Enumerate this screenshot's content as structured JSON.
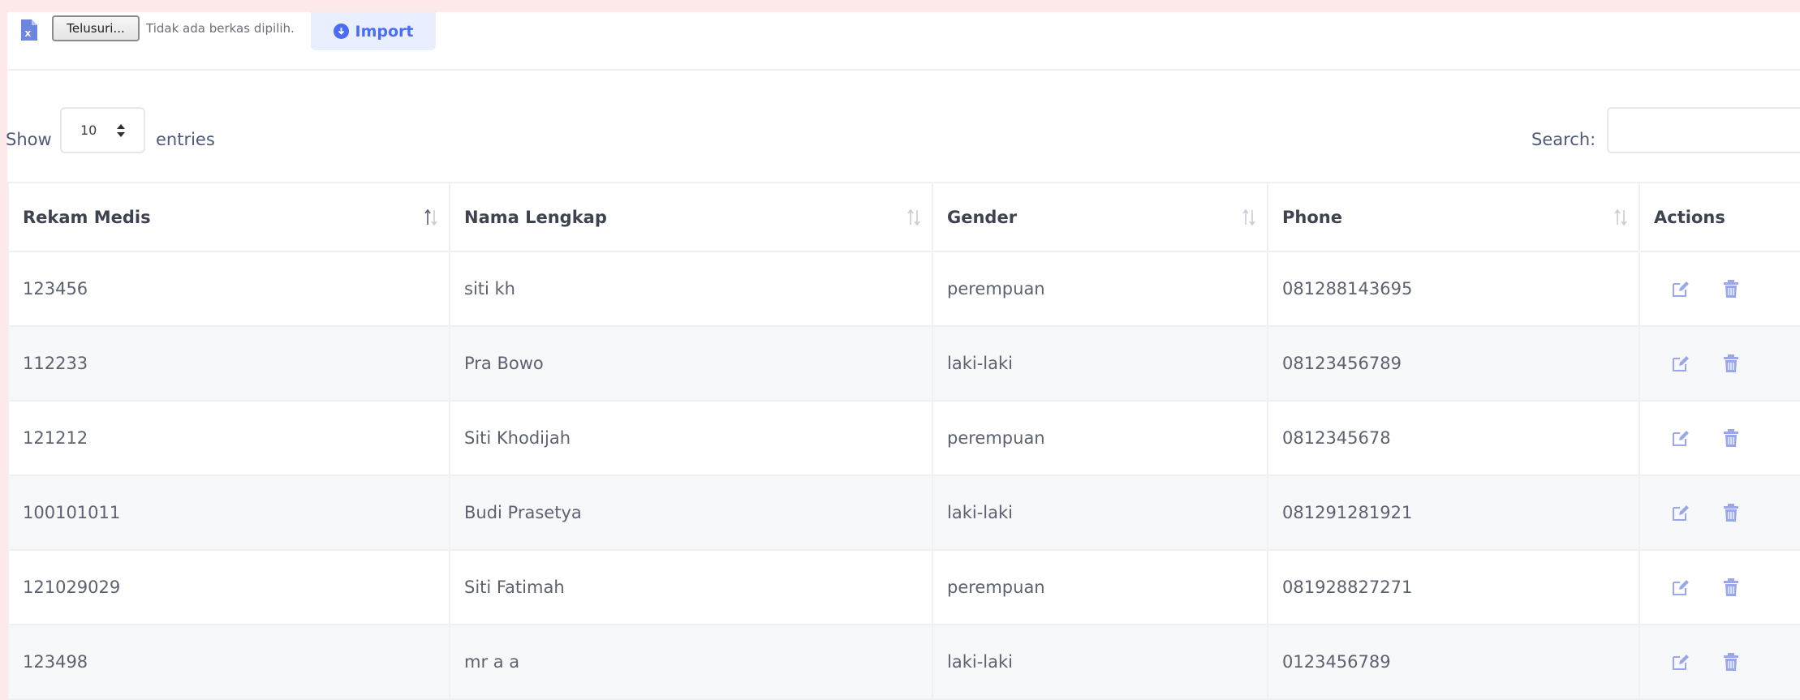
{
  "import_bar": {
    "file_button": "Telusuri...",
    "file_status": "Tidak ada berkas dipilih.",
    "import_label": "Import"
  },
  "length": {
    "show_label": "Show",
    "value": "10",
    "entries_label": "entries"
  },
  "search": {
    "label": "Search:",
    "value": ""
  },
  "table": {
    "headers": [
      "Rekam Medis",
      "Nama Lengkap",
      "Gender",
      "Phone",
      "Actions"
    ],
    "rows": [
      {
        "rm": "123456",
        "nama": "siti kh",
        "gender": "perempuan",
        "phone": "081288143695"
      },
      {
        "rm": "112233",
        "nama": "Pra Bowo",
        "gender": "laki-laki",
        "phone": "08123456789"
      },
      {
        "rm": "121212",
        "nama": "Siti Khodijah",
        "gender": "perempuan",
        "phone": "0812345678"
      },
      {
        "rm": "100101011",
        "nama": "Budi Prasetya",
        "gender": "laki-laki",
        "phone": "081291281921"
      },
      {
        "rm": "121029029",
        "nama": "Siti Fatimah",
        "gender": "perempuan",
        "phone": "081928827271"
      },
      {
        "rm": "123498",
        "nama": "mr a a",
        "gender": "laki-laki",
        "phone": "0123456789"
      }
    ]
  },
  "icons": {
    "file": "excel-file-icon",
    "import": "download-circle-icon",
    "edit": "edit-icon",
    "delete": "trash-icon",
    "sort": "sort-icon"
  },
  "colors": {
    "accent": "#4a6cf7",
    "icon_muted": "#9aa7e8",
    "page_background": "#fde9e9"
  }
}
